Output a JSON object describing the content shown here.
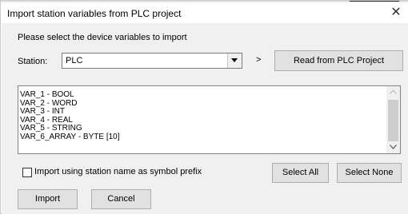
{
  "window": {
    "title": "Import station variables from PLC project",
    "close_symbol": "✕"
  },
  "prompt": "Please select the device variables to import",
  "station": {
    "label": "Station:",
    "value": "PLC",
    "arrow": ">",
    "read_button": "Read from PLC Project"
  },
  "variables": [
    "VAR_1 - BOOL",
    "VAR_2 - WORD",
    "VAR_3 - INT",
    "VAR_4 - REAL",
    "VAR_5 - STRING",
    "VAR_6_ARRAY - BYTE [10]"
  ],
  "prefix_option": {
    "label": "Import using station name as symbol prefix",
    "checked": false
  },
  "buttons": {
    "select_all": "Select All",
    "select_none": "Select None",
    "import": "Import",
    "cancel": "Cancel"
  },
  "icons": {
    "close": "close-icon",
    "dropdown": "chevron-down-icon",
    "scroll_up": "scroll-up-arrow-icon",
    "scroll_down": "scroll-down-arrow-icon"
  }
}
